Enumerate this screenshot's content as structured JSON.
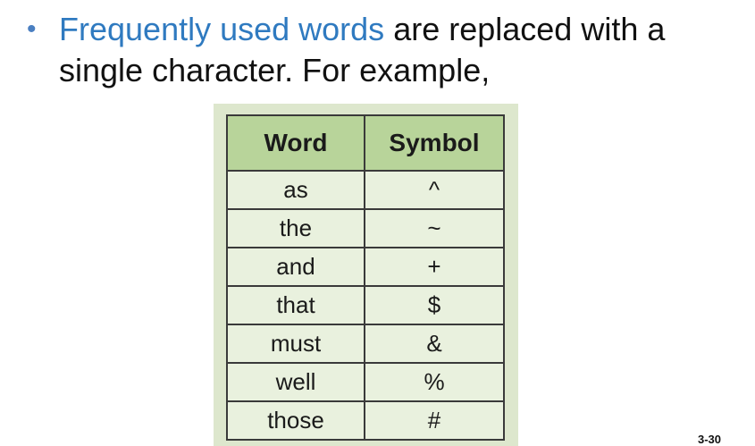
{
  "bullet": {
    "highlight": "Frequently used words",
    "line1_rest": " are replaced with a",
    "line2": "single character. For example,"
  },
  "table": {
    "headers": [
      "Word",
      "Symbol"
    ],
    "rows": [
      {
        "word": "as",
        "symbol": "^"
      },
      {
        "word": "the",
        "symbol": "~"
      },
      {
        "word": "and",
        "symbol": "+"
      },
      {
        "word": "that",
        "symbol": "$"
      },
      {
        "word": "must",
        "symbol": "&"
      },
      {
        "word": "well",
        "symbol": "%"
      },
      {
        "word": "those",
        "symbol": "#"
      }
    ]
  },
  "page_number": "3-30",
  "colors": {
    "highlight": "#2f7ac0",
    "header_bg": "#b8d49a",
    "cell_bg": "#e9f1de",
    "panel_bg": "#dde7cd"
  }
}
